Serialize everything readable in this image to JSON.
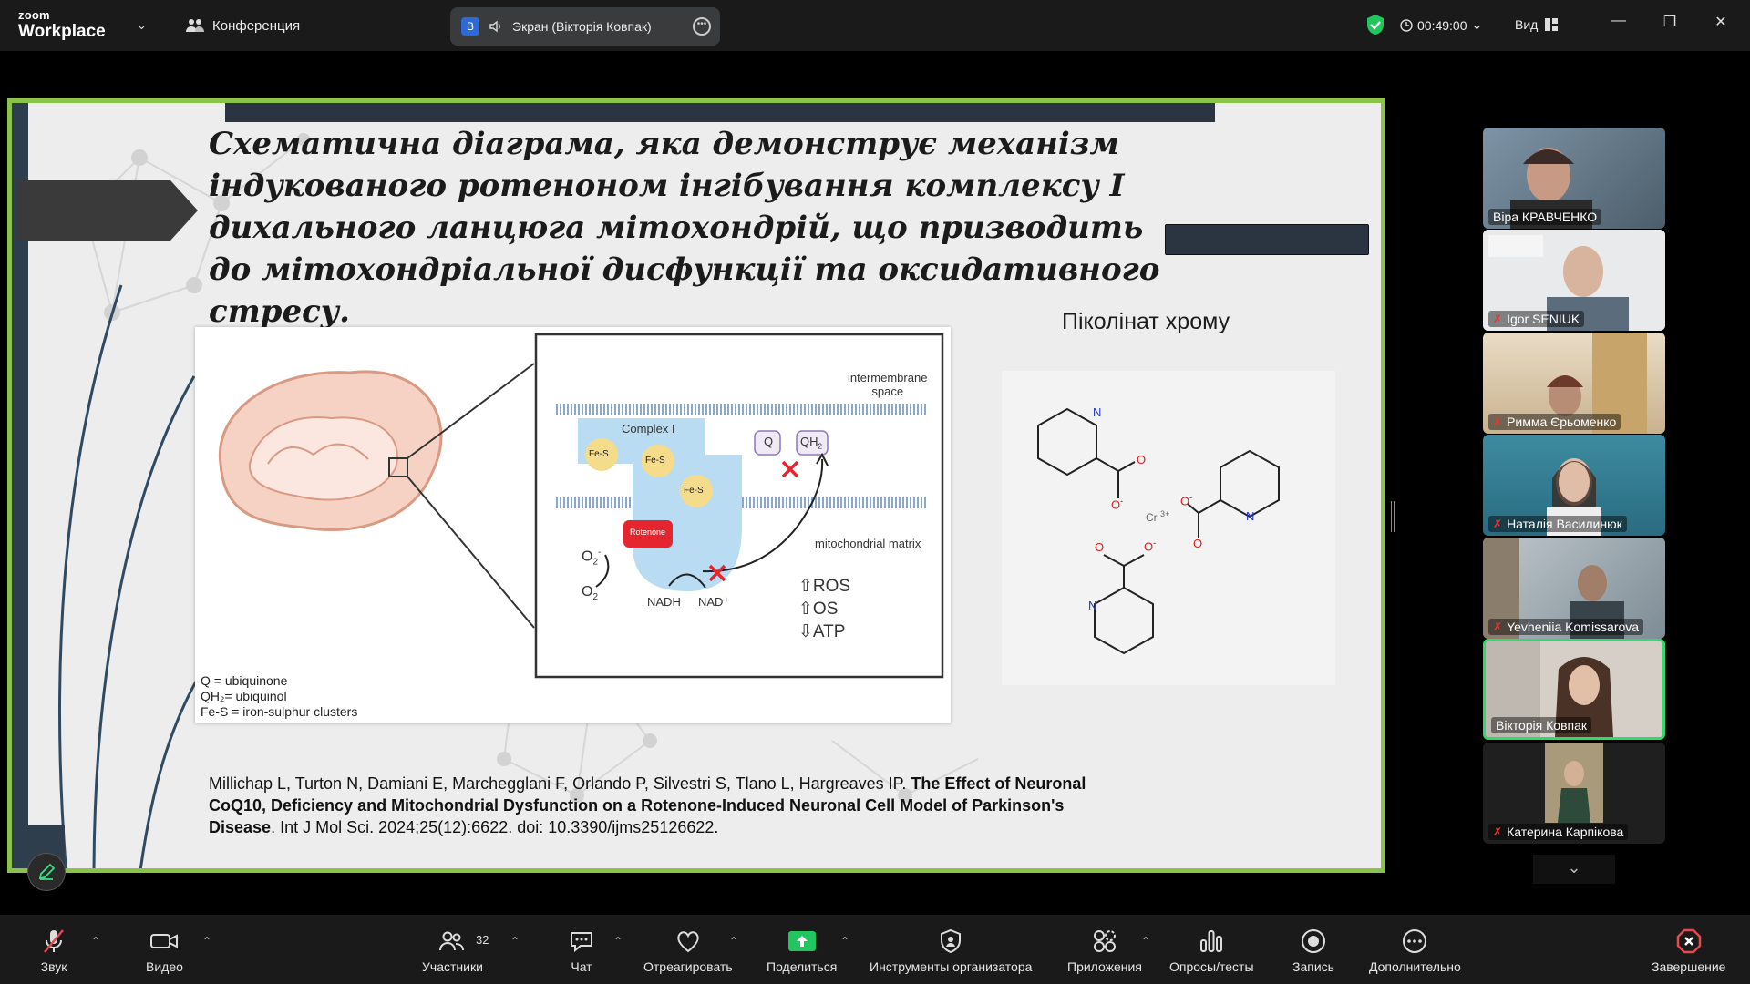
{
  "topbar": {
    "logo_line1": "zoom",
    "logo_line2": "Workplace",
    "meeting_label": "Конференция",
    "share_avatar": "B",
    "share_label": "Экран (Вікторія Ковпак)",
    "timer": "00:49:00",
    "view_label": "Вид",
    "icons": [
      "people-icon",
      "speaker-icon",
      "more-icon",
      "shield-check-icon",
      "clock-icon",
      "grid-icon",
      "minimize-icon",
      "restore-icon",
      "close-icon"
    ]
  },
  "slide": {
    "title": "Схематична діаграма, яка демонструє механізм індукованого ротеноном інгібування комплексу І дихального ланцюга мітохондрій, що призводить до мітохондріальної дисфункції та оксидативного стресу.",
    "chem_label": "Піколінат хрому",
    "diagram": {
      "intermembrane": [
        "intermembrane",
        "space"
      ],
      "complex": "Complex I",
      "fes": [
        "Fe-S",
        "Fe-S",
        "Fe-S"
      ],
      "rotenone": "Rotenone",
      "q": "Q",
      "qh2": "QH",
      "qh2_sub": "2",
      "matrix": "mitochondrial matrix",
      "o2_top": "O",
      "o2_top_sub": "2",
      "o2_top_sup": "-",
      "o2_bottom": "O",
      "o2_bottom_sub": "2",
      "nadh": "NADH",
      "nad": "NAD⁺",
      "ros": "⇧ROS",
      "os": "⇧OS",
      "atp": "⇩ATP",
      "legend": [
        "Q = ubiquinone",
        "QH₂= ubiquinol",
        "Fe-S = iron-sulphur clusters"
      ]
    },
    "chem_atoms": {
      "n": "N",
      "o": "O",
      "o_minus": "O",
      "minus": "-",
      "cr": "Cr",
      "cr_charge": "3+"
    },
    "citation_plain": "Millichap L, Turton N, Damiani E, Marchegglani F, Orlando P, Silvestri S, Tlano L, Hargreaves IP. ",
    "citation_bold": "The Effect of Neuronal CoQ10, Deficiency and Mitochondrial Dysfunction on a Rotenone-Induced Neuronal Cell Model of Parkinson's Disease",
    "citation_tail": ". Int J Mol Sci. 2024;25(12):6622. doi: 10.3390/ijms25126622."
  },
  "participants": [
    {
      "name": "Віра КРАВЧЕНКО",
      "muted": false
    },
    {
      "name": "Igor SENIUK",
      "muted": true
    },
    {
      "name": "Римма Єрьоменко",
      "muted": true
    },
    {
      "name": "Наталія Василинюк",
      "muted": true
    },
    {
      "name": "Yevheniia Komissarova",
      "muted": true
    },
    {
      "name": "Вікторія Ковпак",
      "muted": false,
      "active": true
    },
    {
      "name": "Катерина Карпікова",
      "muted": true
    }
  ],
  "toolbar": {
    "audio": "Звук",
    "video": "Видео",
    "participants": "Участники",
    "participants_count": "32",
    "chat": "Чат",
    "react": "Отреагировать",
    "share": "Поделиться",
    "host_tools": "Инструменты организатора",
    "apps": "Приложения",
    "polls": "Опросы/тесты",
    "record": "Запись",
    "more": "Дополнительно",
    "end": "Завершение",
    "share_color": "#22c55e",
    "end_color": "#e5484d"
  }
}
